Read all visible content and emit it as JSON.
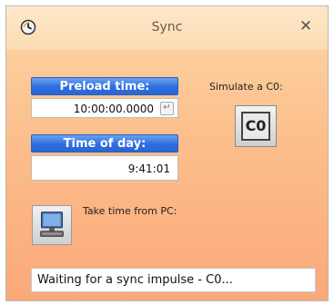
{
  "window": {
    "title": "Sync",
    "close_symbol": "✕",
    "app_icon": "clock-icon"
  },
  "preload": {
    "label": "Preload time:",
    "value": "10:00:00.0000",
    "enter_icon": "enter-icon",
    "enter_symbol": "↵"
  },
  "time_of_day": {
    "label": "Time of day:",
    "value": "9:41:01"
  },
  "simulate": {
    "label": "Simulate a C0:",
    "button_label": "C0"
  },
  "pc_time": {
    "label": "Take time from PC:",
    "icon": "computer-icon"
  },
  "status": {
    "text": "Waiting for a sync impulse - C0..."
  },
  "colors": {
    "label_blue": "#2c6ee0",
    "gradient_top": "#fcd7a6",
    "gradient_bottom": "#fba879"
  }
}
